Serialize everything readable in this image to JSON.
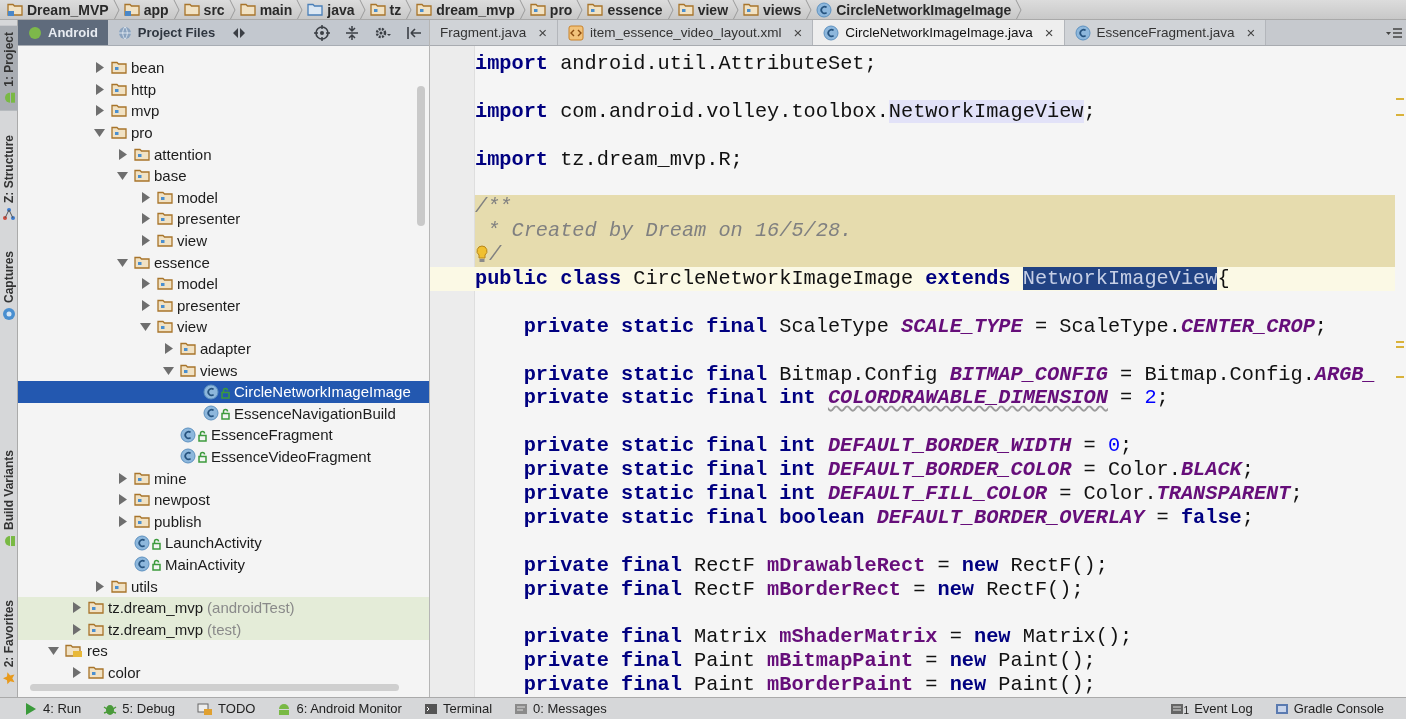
{
  "breadcrumbs": [
    {
      "label": "Dream_MVP",
      "kind": "project"
    },
    {
      "label": "app",
      "kind": "module"
    },
    {
      "label": "src",
      "kind": "folder"
    },
    {
      "label": "main",
      "kind": "folder"
    },
    {
      "label": "java",
      "kind": "source"
    },
    {
      "label": "tz",
      "kind": "package"
    },
    {
      "label": "dream_mvp",
      "kind": "package"
    },
    {
      "label": "pro",
      "kind": "package"
    },
    {
      "label": "essence",
      "kind": "package"
    },
    {
      "label": "view",
      "kind": "package"
    },
    {
      "label": "views",
      "kind": "package"
    },
    {
      "label": "CircleNetworkImageImage",
      "kind": "class"
    }
  ],
  "tool_strip": {
    "top": [
      {
        "label": "1: Project",
        "kind": "project",
        "selected": true
      },
      {
        "label": "Z: Structure",
        "kind": "structure",
        "selected": false
      },
      {
        "label": "Captures",
        "kind": "captures",
        "selected": false
      }
    ],
    "bottom": [
      {
        "label": "Build Variants",
        "kind": "variants",
        "selected": false
      },
      {
        "label": "2: Favorites",
        "kind": "favorites",
        "selected": false
      }
    ]
  },
  "project_panel": {
    "views": [
      {
        "label": "Android",
        "kind": "android",
        "selected": true
      },
      {
        "label": "Project Files",
        "kind": "files",
        "selected": false
      }
    ],
    "tree": [
      {
        "children": [
          {
            "children": [
              {
                "label": "bean",
                "kind": "package",
                "expanded": false,
                "selected": false
              },
              {
                "label": "http",
                "kind": "package",
                "expanded": false,
                "selected": false
              },
              {
                "label": "mvp",
                "kind": "package",
                "expanded": false,
                "selected": false
              },
              {
                "label": "pro",
                "kind": "package",
                "expanded": true,
                "selected": false,
                "children": [
                  {
                    "label": "attention",
                    "kind": "package",
                    "expanded": false,
                    "selected": false
                  },
                  {
                    "label": "base",
                    "kind": "package",
                    "expanded": true,
                    "selected": false,
                    "children": [
                      {
                        "label": "model",
                        "kind": "package",
                        "expanded": false,
                        "selected": false
                      },
                      {
                        "label": "presenter",
                        "kind": "package",
                        "expanded": false,
                        "selected": false
                      },
                      {
                        "label": "view",
                        "kind": "package",
                        "expanded": false,
                        "selected": false
                      }
                    ]
                  },
                  {
                    "label": "essence",
                    "kind": "package",
                    "expanded": true,
                    "selected": false,
                    "children": [
                      {
                        "label": "model",
                        "kind": "package",
                        "expanded": false,
                        "selected": false
                      },
                      {
                        "label": "presenter",
                        "kind": "package",
                        "expanded": false,
                        "selected": false
                      },
                      {
                        "label": "view",
                        "kind": "package",
                        "expanded": true,
                        "selected": false,
                        "children": [
                          {
                            "label": "adapter",
                            "kind": "package",
                            "expanded": false,
                            "selected": false
                          },
                          {
                            "label": "views",
                            "kind": "package",
                            "expanded": true,
                            "selected": false,
                            "children": [
                              {
                                "label": "CircleNetworkImageImage",
                                "kind": "class",
                                "selected": true
                              },
                              {
                                "label": "EssenceNavigationBuild",
                                "kind": "class",
                                "selected": false
                              }
                            ]
                          },
                          {
                            "label": "EssenceFragment",
                            "kind": "class",
                            "selected": false
                          },
                          {
                            "label": "EssenceVideoFragment",
                            "kind": "class",
                            "selected": false
                          }
                        ]
                      }
                    ]
                  },
                  {
                    "label": "mine",
                    "kind": "package",
                    "expanded": false,
                    "selected": false
                  },
                  {
                    "label": "newpost",
                    "kind": "package",
                    "expanded": false,
                    "selected": false
                  },
                  {
                    "label": "publish",
                    "kind": "package",
                    "expanded": false,
                    "selected": false
                  },
                  {
                    "label": "LaunchActivity",
                    "kind": "class",
                    "selected": false
                  },
                  {
                    "label": "MainActivity",
                    "kind": "class",
                    "selected": false
                  }
                ]
              },
              {
                "label": "utils",
                "kind": "package",
                "expanded": false,
                "selected": false
              }
            ]
          },
          {
            "label": "tz.dream_mvp",
            "note": "(androidTest)",
            "kind": "test",
            "expanded": false,
            "selected": false
          },
          {
            "label": "tz.dream_mvp",
            "note": "(test)",
            "kind": "test",
            "expanded": false,
            "selected": false
          }
        ]
      },
      {
        "label": "res",
        "kind": "res",
        "expanded": true,
        "selected": false,
        "children": [
          {
            "label": "color",
            "kind": "package",
            "expanded": false,
            "selected": false
          }
        ]
      }
    ]
  },
  "editor_tabs": [
    {
      "label": "Fragment.java",
      "kind": "clipped",
      "close": "×",
      "selected": false
    },
    {
      "label": "item_essence_video_layout.xml",
      "kind": "xml",
      "close": "×",
      "selected": false
    },
    {
      "label": "CircleNetworkImageImage.java",
      "kind": "class",
      "close": "×",
      "selected": true
    },
    {
      "label": "EssenceFragment.java",
      "kind": "class",
      "close": "×",
      "selected": false
    }
  ],
  "code_lines": [
    {
      "kind": "code",
      "tokens": [
        {
          "kind": "kw",
          "text": "import"
        },
        {
          "kind": "plain",
          "text": " android.util.AttributeSet;"
        }
      ]
    },
    {
      "kind": "blank"
    },
    {
      "kind": "code",
      "tokens": [
        {
          "kind": "kw",
          "text": "import"
        },
        {
          "kind": "plain",
          "text": " com.android.volley.toolbox."
        },
        {
          "kind": "ref",
          "text": "NetworkImageView"
        },
        {
          "kind": "plain",
          "text": ";"
        }
      ]
    },
    {
      "kind": "blank"
    },
    {
      "kind": "code",
      "tokens": [
        {
          "kind": "kw",
          "text": "import"
        },
        {
          "kind": "plain",
          "text": " tz.dream_mvp.R;"
        }
      ]
    },
    {
      "kind": "blank"
    },
    {
      "kind": "doc",
      "tokens": [
        {
          "kind": "comment",
          "text": "/**"
        }
      ]
    },
    {
      "kind": "doc",
      "tokens": [
        {
          "kind": "comment",
          "text": " * Created by Dream on 16/5/28."
        }
      ]
    },
    {
      "kind": "doc",
      "tokens": [
        {
          "kind": "bulb"
        },
        {
          "kind": "comment",
          "text": "/"
        }
      ]
    },
    {
      "kind": "current",
      "tokens": [
        {
          "kind": "kw",
          "text": "public class"
        },
        {
          "kind": "plain",
          "text": " CircleNetworkImageImage "
        },
        {
          "kind": "kw",
          "text": "extends "
        },
        {
          "kind": "selected",
          "text": "NetworkImageView"
        },
        {
          "kind": "plain",
          "text": "{"
        }
      ]
    },
    {
      "kind": "blank"
    },
    {
      "kind": "code",
      "tokens": [
        {
          "kind": "kw",
          "text": "    private static final"
        },
        {
          "kind": "plain",
          "text": " ScaleType "
        },
        {
          "kind": "const",
          "text": "SCALE_TYPE"
        },
        {
          "kind": "plain",
          "text": " = ScaleType."
        },
        {
          "kind": "const",
          "text": "CENTER_CROP"
        },
        {
          "kind": "plain",
          "text": ";"
        }
      ]
    },
    {
      "kind": "blank"
    },
    {
      "kind": "code",
      "tokens": [
        {
          "kind": "kw",
          "text": "    private static final"
        },
        {
          "kind": "plain",
          "text": " Bitmap.Config "
        },
        {
          "kind": "const",
          "text": "BITMAP_CONFIG"
        },
        {
          "kind": "plain",
          "text": " = Bitmap.Config."
        },
        {
          "kind": "const",
          "text": "ARGB_"
        }
      ]
    },
    {
      "kind": "code",
      "tokens": [
        {
          "kind": "kw",
          "text": "    private static final int "
        },
        {
          "kind": "warn",
          "text": "COLORDRAWABLE_DIMENSION"
        },
        {
          "kind": "plain",
          "text": " = "
        },
        {
          "kind": "num",
          "text": "2"
        },
        {
          "kind": "plain",
          "text": ";"
        }
      ]
    },
    {
      "kind": "blank"
    },
    {
      "kind": "code",
      "tokens": [
        {
          "kind": "kw",
          "text": "    private static final int "
        },
        {
          "kind": "const",
          "text": "DEFAULT_BORDER_WIDTH"
        },
        {
          "kind": "plain",
          "text": " = "
        },
        {
          "kind": "num",
          "text": "0"
        },
        {
          "kind": "plain",
          "text": ";"
        }
      ]
    },
    {
      "kind": "code",
      "tokens": [
        {
          "kind": "kw",
          "text": "    private static final int "
        },
        {
          "kind": "const",
          "text": "DEFAULT_BORDER_COLOR"
        },
        {
          "kind": "plain",
          "text": " = Color."
        },
        {
          "kind": "const",
          "text": "BLACK"
        },
        {
          "kind": "plain",
          "text": ";"
        }
      ]
    },
    {
      "kind": "code",
      "tokens": [
        {
          "kind": "kw",
          "text": "    private static final int "
        },
        {
          "kind": "const",
          "text": "DEFAULT_FILL_COLOR"
        },
        {
          "kind": "plain",
          "text": " = Color."
        },
        {
          "kind": "const",
          "text": "TRANSPARENT"
        },
        {
          "kind": "plain",
          "text": ";"
        }
      ]
    },
    {
      "kind": "code",
      "tokens": [
        {
          "kind": "kw",
          "text": "    private static final boolean "
        },
        {
          "kind": "const",
          "text": "DEFAULT_BORDER_OVERLAY"
        },
        {
          "kind": "plain",
          "text": " = "
        },
        {
          "kind": "kw",
          "text": "false"
        },
        {
          "kind": "plain",
          "text": ";"
        }
      ]
    },
    {
      "kind": "blank"
    },
    {
      "kind": "code",
      "tokens": [
        {
          "kind": "kw",
          "text": "    private final"
        },
        {
          "kind": "plain",
          "text": " RectF "
        },
        {
          "kind": "field",
          "text": "mDrawableRect"
        },
        {
          "kind": "plain",
          "text": " = "
        },
        {
          "kind": "kw",
          "text": "new"
        },
        {
          "kind": "plain",
          "text": " RectF();"
        }
      ]
    },
    {
      "kind": "code",
      "tokens": [
        {
          "kind": "kw",
          "text": "    private final"
        },
        {
          "kind": "plain",
          "text": " RectF "
        },
        {
          "kind": "field",
          "text": "mBorderRect"
        },
        {
          "kind": "plain",
          "text": " = "
        },
        {
          "kind": "kw",
          "text": "new"
        },
        {
          "kind": "plain",
          "text": " RectF();"
        }
      ]
    },
    {
      "kind": "blank"
    },
    {
      "kind": "code",
      "tokens": [
        {
          "kind": "kw",
          "text": "    private final"
        },
        {
          "kind": "plain",
          "text": " Matrix "
        },
        {
          "kind": "field",
          "text": "mShaderMatrix"
        },
        {
          "kind": "plain",
          "text": " = "
        },
        {
          "kind": "kw",
          "text": "new"
        },
        {
          "kind": "plain",
          "text": " Matrix();"
        }
      ]
    },
    {
      "kind": "code",
      "tokens": [
        {
          "kind": "kw",
          "text": "    private final"
        },
        {
          "kind": "plain",
          "text": " Paint "
        },
        {
          "kind": "field",
          "text": "mBitmapPaint"
        },
        {
          "kind": "plain",
          "text": " = "
        },
        {
          "kind": "kw",
          "text": "new"
        },
        {
          "kind": "plain",
          "text": " Paint();"
        }
      ]
    },
    {
      "kind": "code",
      "tokens": [
        {
          "kind": "kw",
          "text": "    private final"
        },
        {
          "kind": "plain",
          "text": " Paint "
        },
        {
          "kind": "field",
          "text": "mBorderPaint"
        },
        {
          "kind": "plain",
          "text": " = "
        },
        {
          "kind": "kw",
          "text": "new"
        },
        {
          "kind": "plain",
          "text": " Paint();"
        }
      ]
    }
  ],
  "bottom_bar": {
    "left": [
      {
        "label": "4: Run",
        "kind": "run"
      },
      {
        "label": "5: Debug",
        "kind": "debug"
      },
      {
        "label": "TODO",
        "kind": "todo"
      },
      {
        "label": "6: Android Monitor",
        "kind": "monitor"
      },
      {
        "label": "Terminal",
        "kind": "terminal"
      },
      {
        "label": "0: Messages",
        "kind": "messages"
      }
    ],
    "right": [
      {
        "label": "Event Log",
        "kind": "log",
        "count": "1"
      },
      {
        "label": "Gradle Console",
        "kind": "gradle"
      }
    ]
  }
}
